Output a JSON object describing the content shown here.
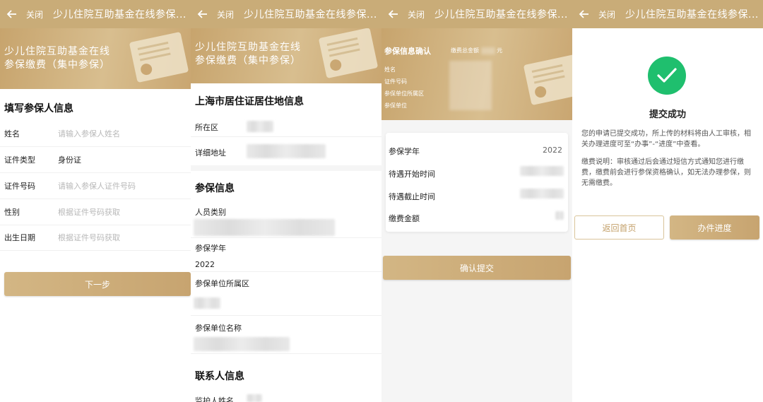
{
  "navbar": {
    "close_label": "关闭",
    "title": "少儿住院互助基金在线参保..."
  },
  "colors": {
    "gold": "#c9ac78",
    "success_green": "#1fbf6e"
  },
  "panel1": {
    "banner_line1": "少儿住院互助基金在线",
    "banner_line2": "参保缴费（集中参保）",
    "section_title": "填写参保人信息",
    "fields": [
      {
        "label": "姓名",
        "placeholder": "请输入参保人姓名"
      },
      {
        "label": "证件类型",
        "value": "身份证"
      },
      {
        "label": "证件号码",
        "placeholder": "请输入参保人证件号码"
      },
      {
        "label": "性别",
        "placeholder": "根据证件号码获取"
      },
      {
        "label": "出生日期",
        "placeholder": "根据证件号码获取"
      }
    ],
    "next_button": "下一步"
  },
  "panel2": {
    "banner_line1": "少儿住院互助基金在线",
    "banner_line2": "参保缴费（集中参保）",
    "residence_title": "上海市居住证居住地信息",
    "district_label": "所在区",
    "address_label": "详细地址",
    "insurance_title": "参保信息",
    "person_type_label": "人员类别",
    "school_year_label": "参保学年",
    "school_year_value": "2022",
    "unit_district_label": "参保单位所属区",
    "unit_name_label": "参保单位名称",
    "contact_title": "联系人信息",
    "guardian_label": "监护人姓名"
  },
  "panel3": {
    "confirm_title": "参保信息确认",
    "total_prefix": "缴费总金额",
    "total_suffix": "元",
    "banner_fields": [
      "姓名",
      "证件号码",
      "参保单位所属区",
      "参保单位"
    ],
    "rows": [
      {
        "label": "参保学年",
        "value": "2022"
      },
      {
        "label": "待遇开始时间"
      },
      {
        "label": "待遇截止时间"
      },
      {
        "label": "缴费金额"
      }
    ],
    "submit_button": "确认提交"
  },
  "panel4": {
    "success_title": "提交成功",
    "message": "您的申请已提交成功，所上传的材料将由人工审核，相关办理进度可至“办事”-“进度”中查看。",
    "note": "缴费说明：审核通过后会通过短信方式通知您进行缴费，缴费前会进行参保资格确认，如无法办理参保，则无需缴费。",
    "home_button": "返回首页",
    "progress_button": "办件进度"
  }
}
